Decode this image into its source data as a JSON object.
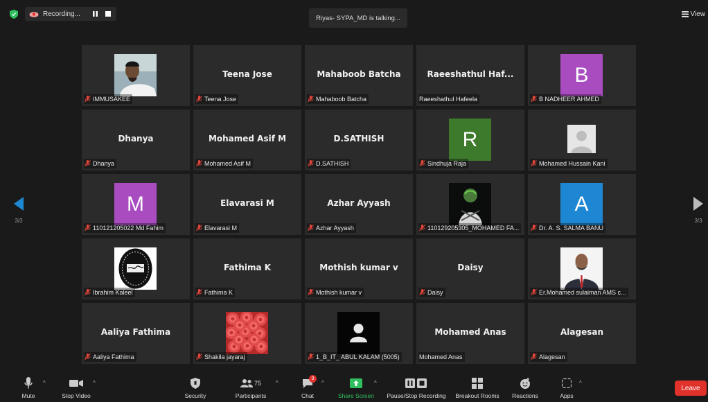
{
  "topbar": {
    "recording_label": "Recording...",
    "talking": "Riyas- SYPA_MD is talking...",
    "view_label": "View"
  },
  "page_nav": {
    "left": "3/3",
    "right": "3/3"
  },
  "tiles": [
    {
      "name": "IMMUSAKEE",
      "big": "",
      "kind": "photo-man"
    },
    {
      "name": "Teena Jose",
      "big": "Teena Jose",
      "kind": "none"
    },
    {
      "name": "Mahaboob Batcha",
      "big": "Mahaboob Batcha",
      "kind": "none"
    },
    {
      "name": "Raeeshathul Hafeela",
      "big": "Raeeshathul Haf...",
      "kind": "none",
      "unmuted": true
    },
    {
      "name": "B NADHEER AHMED",
      "big": "",
      "kind": "letter",
      "letter": "B",
      "color": "#a94cc0"
    },
    {
      "name": "Dhanya",
      "big": "Dhanya",
      "kind": "none"
    },
    {
      "name": "Mohamed Asif M",
      "big": "Mohamed Asif M",
      "kind": "none"
    },
    {
      "name": "D.SATHISH",
      "big": "D.SATHISH",
      "kind": "none"
    },
    {
      "name": "Sindhuja Raja",
      "big": "",
      "kind": "letter",
      "letter": "R",
      "color": "#3d7a2b"
    },
    {
      "name": "Mohamed Hussain Kani",
      "big": "",
      "kind": "avatar-default"
    },
    {
      "name": "110121205022 Md Fahim",
      "big": "",
      "kind": "letter",
      "letter": "M",
      "color": "#a94cc0"
    },
    {
      "name": "Elavarasi M",
      "big": "Elavarasi M",
      "kind": "none"
    },
    {
      "name": "Azhar Ayyash",
      "big": "Azhar Ayyash",
      "kind": "none"
    },
    {
      "name": "110129205305_MOHAMED FA...",
      "big": "",
      "kind": "photo-dark"
    },
    {
      "name": "Dr.  A. S. SALMA BANU",
      "big": "",
      "kind": "letter",
      "letter": "A",
      "color": "#1e87d4"
    },
    {
      "name": "Ibrahim Kaleel",
      "big": "",
      "kind": "photo-seal"
    },
    {
      "name": "Fathima K",
      "big": "Fathima K",
      "kind": "none"
    },
    {
      "name": "Mothish kumar v",
      "big": "Mothish kumar v",
      "kind": "none"
    },
    {
      "name": "Daisy",
      "big": "Daisy",
      "kind": "none"
    },
    {
      "name": "Er.Mohamed sulaiman AMS c...",
      "big": "",
      "kind": "photo-suit"
    },
    {
      "name": "Aaliya Fathima",
      "big": "Aaliya Fathima",
      "kind": "none"
    },
    {
      "name": "Shakila jayaraj",
      "big": "",
      "kind": "photo-roses"
    },
    {
      "name": "1_B_IT_ ABUL KALAM (5005)",
      "big": "",
      "kind": "avatar-black"
    },
    {
      "name": "Mohamed Anas",
      "big": "Mohamed Anas",
      "kind": "none",
      "unmuted": true
    },
    {
      "name": "Alagesan",
      "big": "Alagesan",
      "kind": "none"
    }
  ],
  "toolbar": {
    "mute": "Mute",
    "stop_video": "Stop Video",
    "security": "Security",
    "participants": "Participants",
    "participants_count": "75",
    "chat": "Chat",
    "chat_badge": "3",
    "share": "Share Screen",
    "pause_rec": "Pause/Stop Recording",
    "breakout": "Breakout Rooms",
    "reactions": "Reactions",
    "apps": "Apps",
    "leave": "Leave"
  },
  "colors": {
    "accent_green": "#2fbf5f",
    "leave_red": "#e0312b",
    "muted_red": "#e0453a"
  }
}
